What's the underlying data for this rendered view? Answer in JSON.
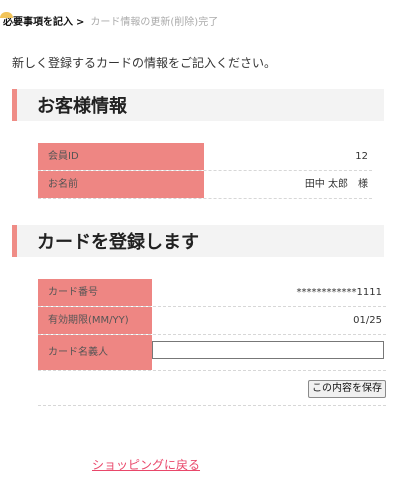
{
  "breadcrumb": {
    "step_active": "必要事項を記入",
    "separator": ">",
    "step_next": "カード情報の更新(削除)完了"
  },
  "intro_text": "新しく登録するカードの情報をご記入ください。",
  "customer_section": {
    "title": "お客様情報",
    "member_id_label": "会員ID",
    "member_id_value": "12",
    "name_label": "お名前",
    "name_value": "田中 太郎　様"
  },
  "card_section": {
    "title": "カードを登録します",
    "card_number_label": "カード番号",
    "card_number_value": "************1111",
    "expiry_label": "有効期限(MM/YY)",
    "expiry_value": "01/25",
    "holder_label": "カード名義人",
    "holder_value": "",
    "save_label": "この内容を保存"
  },
  "back_link_label": "ショッピングに戻る",
  "colors": {
    "accent": "#ef8c86",
    "link": "#e9476a",
    "step_marker": "#f2c45a"
  }
}
